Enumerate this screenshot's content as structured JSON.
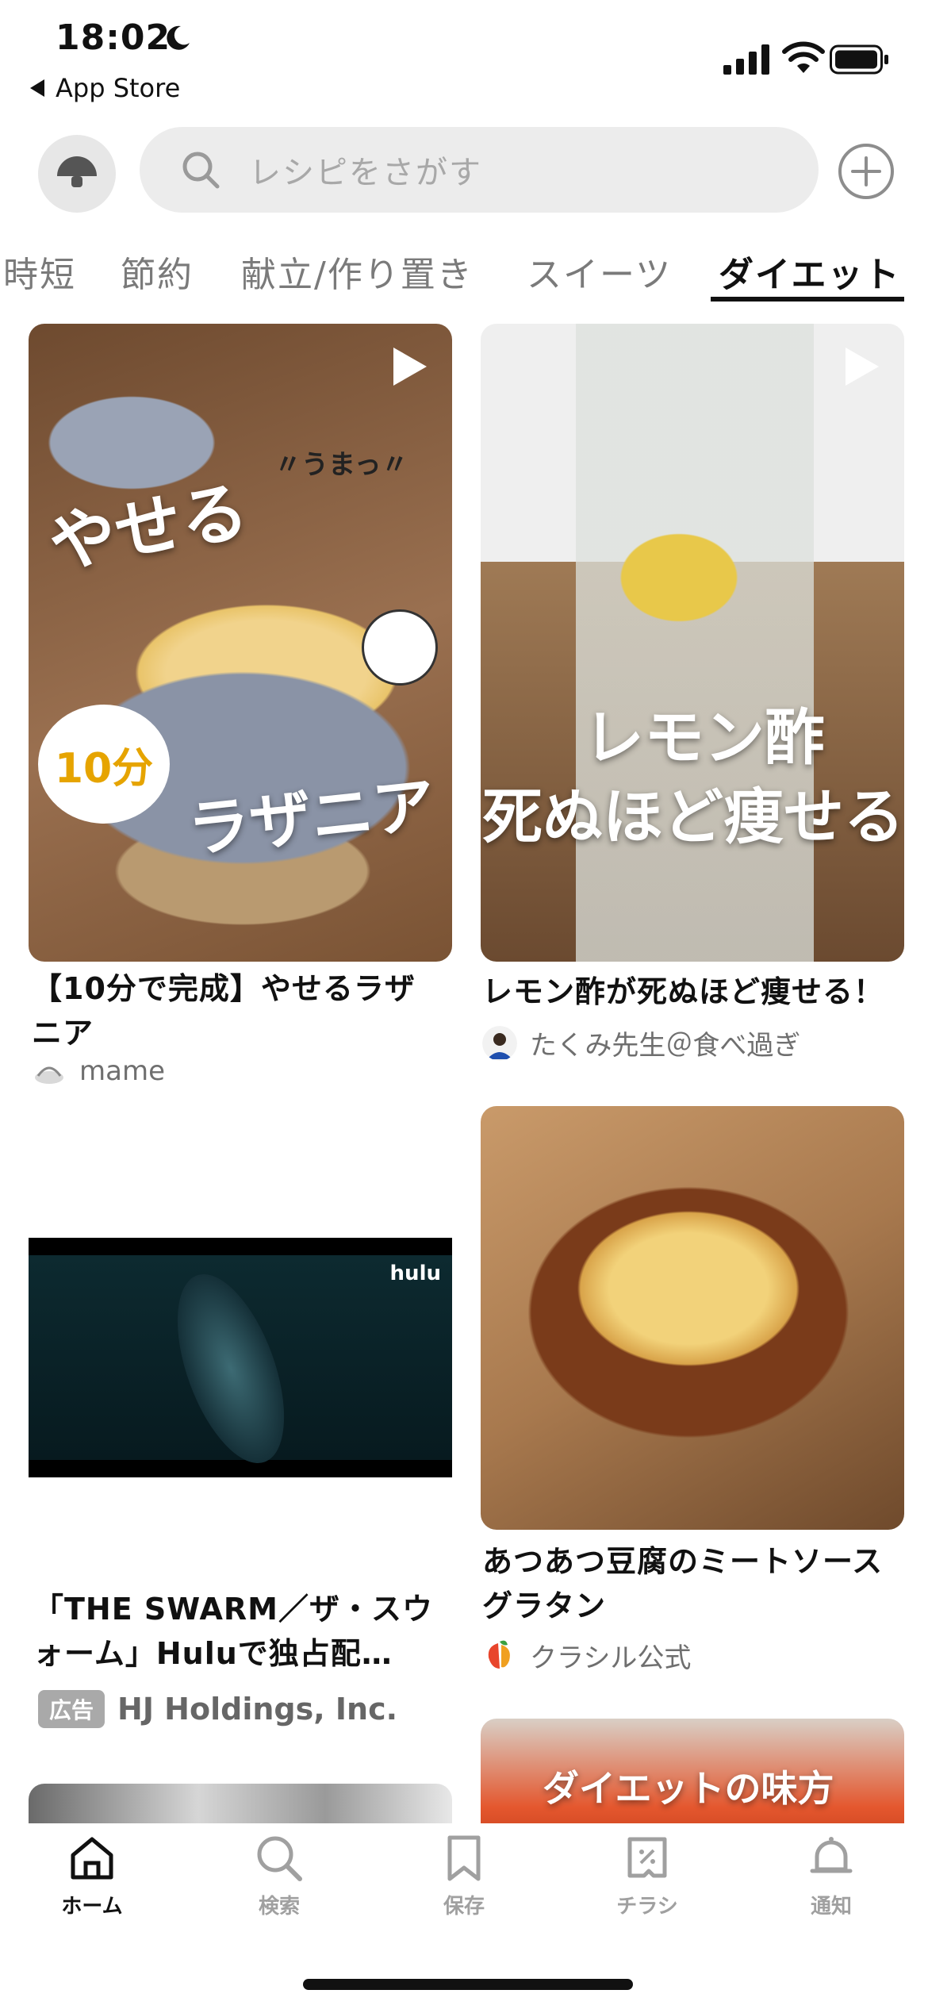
{
  "status_bar": {
    "time": "18:02",
    "back_label": "App Store"
  },
  "search": {
    "placeholder": "レシピをさがす"
  },
  "tabs": [
    {
      "label": "時短"
    },
    {
      "label": "節約"
    },
    {
      "label": "献立/作り置き"
    },
    {
      "label": "スイーツ"
    },
    {
      "label": "ダイエット",
      "active": true
    }
  ],
  "cards": [
    {
      "title": "【10分で完成】やせるラザニア",
      "author": "mame",
      "image_text_1": "やせる",
      "image_text_2": "ラザニア",
      "image_text_3": "10分",
      "image_text_4": "〃うまっ〃"
    },
    {
      "title": "レモン酢が死ぬほど痩せる！",
      "author": "たくみ先生＠食べ過ぎ",
      "image_text_1": "レモン酢",
      "image_text_2": "死ぬほど痩せる"
    },
    {
      "title": "あつあつ豆腐のミートソースグラタン",
      "author": "クラシル公式"
    },
    {
      "image_text_1": "ダイエットの味方"
    }
  ],
  "ad": {
    "title": "「THE SWARM／ザ・スウォーム」Huluで独占配…",
    "badge": "広告",
    "advertiser": "HJ Holdings, Inc.",
    "brand": "hulu"
  },
  "bottom_nav": [
    {
      "label": "ホーム",
      "icon": "home-icon",
      "active": true
    },
    {
      "label": "検索",
      "icon": "search-icon"
    },
    {
      "label": "保存",
      "icon": "bookmark-icon"
    },
    {
      "label": "チラシ",
      "icon": "flyer-icon"
    },
    {
      "label": "通知",
      "icon": "bell-icon"
    }
  ]
}
